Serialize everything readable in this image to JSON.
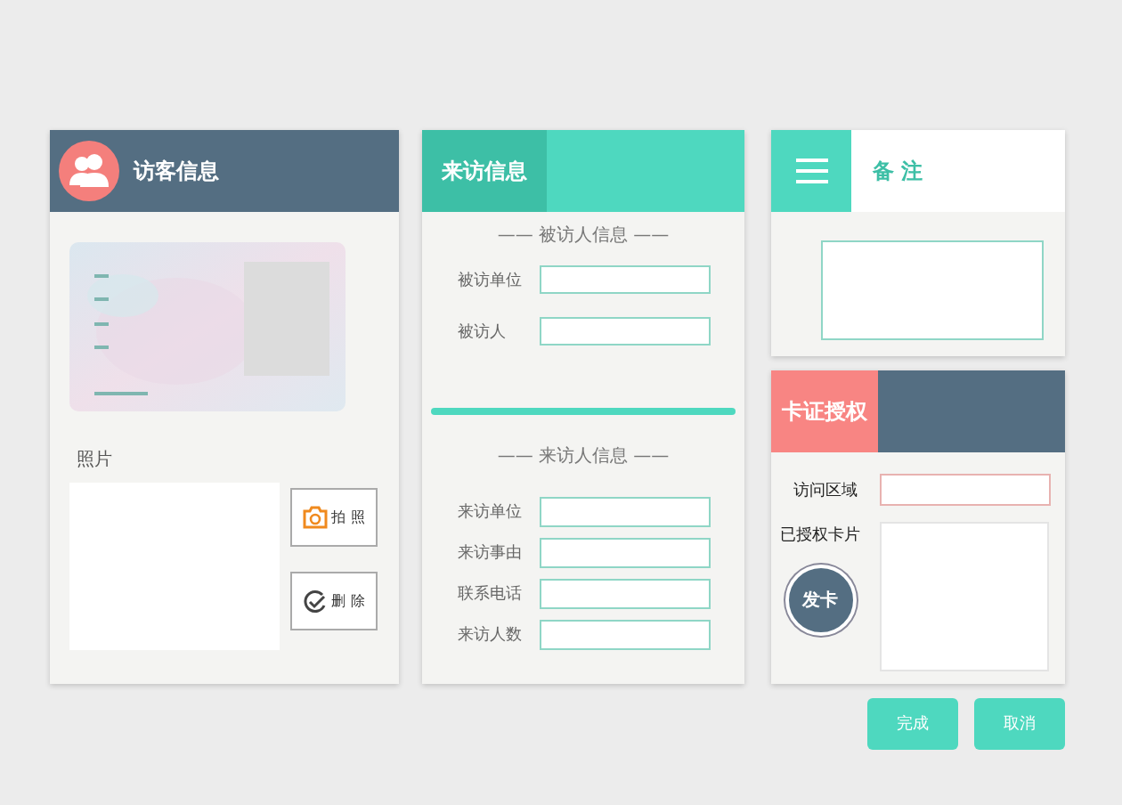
{
  "visitor_panel": {
    "title": "访客信息",
    "photo_label": "照片",
    "buttons": [
      {
        "kind": "camera",
        "label": "拍 照"
      },
      {
        "kind": "delete",
        "label": "删 除"
      }
    ]
  },
  "visit_panel": {
    "title": "来访信息",
    "sections": [
      {
        "heading": "—— 被访人信息 ——",
        "fields": [
          {
            "label": "被访单位"
          },
          {
            "label": "被访人"
          }
        ]
      },
      {
        "heading": "—— 来访人信息 ——",
        "fields": [
          {
            "label": "来访单位"
          },
          {
            "label": "来访事由"
          },
          {
            "label": "联系电话"
          },
          {
            "label": "来访人数"
          }
        ]
      }
    ]
  },
  "notes_panel": {
    "title": "备 注"
  },
  "card_panel": {
    "title": "卡证授权",
    "area_label": "访问区域",
    "cards_label": "已授权卡片",
    "issue_button": "发卡"
  },
  "actions": [
    "完成",
    "取消"
  ]
}
